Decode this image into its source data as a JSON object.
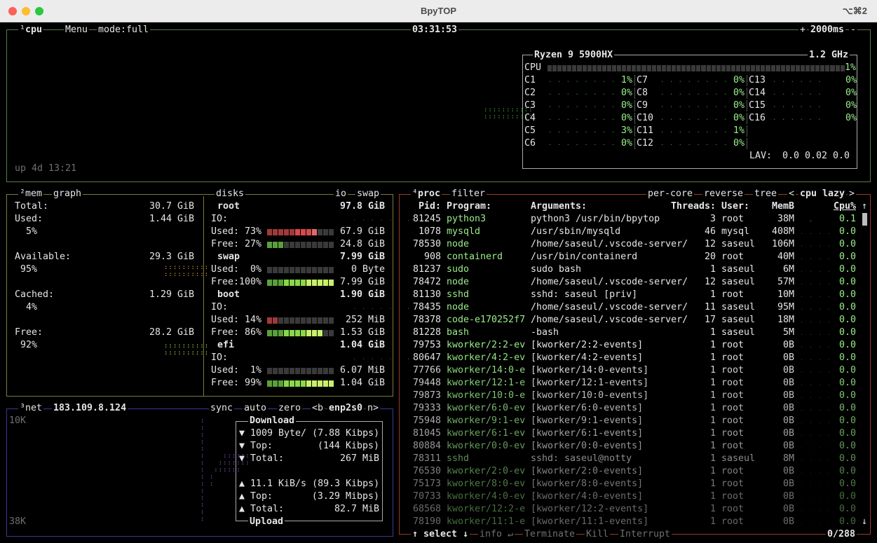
{
  "window": {
    "title": "BpyTOP",
    "shortcut": "⌥⌘2"
  },
  "cpu": {
    "num": "¹",
    "title": "cpu",
    "menu": "Menu",
    "mode": "mode:full",
    "time": "03:31:53",
    "plus": "+",
    "interval": "2000ms",
    "minus": "-",
    "uptime": "up 4d 13:21",
    "model": "Ryzen 9 5900HX",
    "freq": "1.2 GHz",
    "total_label": "CPU",
    "total_pct": "1%",
    "cores": [
      {
        "name": "C1",
        "pct": "1%"
      },
      {
        "name": "C2",
        "pct": "0%"
      },
      {
        "name": "C3",
        "pct": "0%"
      },
      {
        "name": "C4",
        "pct": "0%"
      },
      {
        "name": "C5",
        "pct": "3%"
      },
      {
        "name": "C6",
        "pct": "0%"
      },
      {
        "name": "C7",
        "pct": "0%"
      },
      {
        "name": "C8",
        "pct": "0%"
      },
      {
        "name": "C9",
        "pct": "0%"
      },
      {
        "name": "C10",
        "pct": "0%"
      },
      {
        "name": "C11",
        "pct": "1%"
      },
      {
        "name": "C12",
        "pct": "0%"
      },
      {
        "name": "C13",
        "pct": "0%"
      },
      {
        "name": "C14",
        "pct": "0%"
      },
      {
        "name": "C15",
        "pct": "0%"
      },
      {
        "name": "C16",
        "pct": "0%"
      }
    ],
    "lav_label": "LAV:",
    "lav": "0.0 0.02 0.0"
  },
  "mem": {
    "num": "²",
    "title": "mem",
    "graph": "graph",
    "total_l": "Total:",
    "total_v": "30.7 GiB",
    "used_l": "Used:",
    "used_v": "1.44 GiB",
    "used_p": "5%",
    "avail_l": "Available:",
    "avail_v": "29.3 GiB",
    "avail_p": "95%",
    "cached_l": "Cached:",
    "cached_v": "1.29 GiB",
    "cached_p": "4%",
    "free_l": "Free:",
    "free_v": "28.2 GiB",
    "free_p": "92%"
  },
  "disks": {
    "title": "disks",
    "io": "io",
    "swap": "swap",
    "io_label": "IO:",
    "items": [
      {
        "name": "root",
        "total": "97.8 GiB",
        "has_io": true,
        "used_l": "Used: 73%",
        "used_v": "67.9 GiB",
        "used_frac": 0.73,
        "free_l": "Free: 27%",
        "free_v": "24.8 GiB",
        "free_frac": 0.27
      },
      {
        "name": "swap",
        "total": "7.99 GiB",
        "has_io": false,
        "used_l": "Used:  0%",
        "used_v": "0 Byte",
        "used_frac": 0.0,
        "free_l": "Free:100%",
        "free_v": "7.99 GiB",
        "free_frac": 1.0
      },
      {
        "name": "boot",
        "total": "1.90 GiB",
        "has_io": true,
        "used_l": "Used: 14%",
        "used_v": "252 MiB",
        "used_frac": 0.14,
        "free_l": "Free: 86%",
        "free_v": "1.53 GiB",
        "free_frac": 0.86
      },
      {
        "name": "efi",
        "total": "1.04 GiB",
        "has_io": true,
        "used_l": "Used:  1%",
        "used_v": "6.07 MiB",
        "used_frac": 0.01,
        "free_l": "Free: 99%",
        "free_v": "1.04 GiB",
        "free_frac": 0.99
      }
    ]
  },
  "net": {
    "num": "³",
    "title": "net",
    "ip": "183.109.8.124",
    "sync": "sync",
    "auto": "auto",
    "zero": "zero",
    "prev": "<b",
    "iface": "enp2s0",
    "next": "n>",
    "scale_top": "10K",
    "scale_bottom": "38K",
    "download": "Download",
    "dl_rate": "▼ 1009 Byte/ (7.88 Kibps)",
    "dl_top_l": "▼ Top:",
    "dl_top_v": "(144 Kibps)",
    "dl_total_l": "▼ Total:",
    "dl_total_v": "267 MiB",
    "ul_rate": "▲ 11.1 KiB/s (89.3 Kibps)",
    "ul_top_l": "▲ Top:",
    "ul_top_v": "(3.29 Mibps)",
    "ul_total_l": "▲ Total:",
    "ul_total_v": "82.7 MiB",
    "upload": "Upload"
  },
  "proc": {
    "num": "⁴",
    "title": "proc",
    "filter": "filter",
    "percore": "per-core",
    "reverse": "reverse",
    "tree": "tree",
    "lt": "<",
    "sort": "cpu lazy",
    "gt": ">",
    "headers": {
      "pid": "Pid:",
      "program": "Program:",
      "args": "Arguments:",
      "threads": "Threads:",
      "user": "User:",
      "mem": "MemB",
      "cpu": "Cpu%"
    },
    "up_arrow": "↑",
    "down_arrow": "↓",
    "rows": [
      [
        "81245",
        "python3",
        "python3 /usr/bin/bpytop",
        "3",
        "root",
        "38M",
        "0.1"
      ],
      [
        "1078",
        "mysqld",
        "/usr/sbin/mysqld",
        "46",
        "mysql",
        "408M",
        "0.0"
      ],
      [
        "78530",
        "node",
        "/home/saseul/.vscode-server/",
        "12",
        "saseul",
        "106M",
        "0.0"
      ],
      [
        "908",
        "containerd",
        "/usr/bin/containerd",
        "20",
        "root",
        "40M",
        "0.0"
      ],
      [
        "81237",
        "sudo",
        "sudo bash",
        "1",
        "saseul",
        "6M",
        "0.0"
      ],
      [
        "78472",
        "node",
        "/home/saseul/.vscode-server/",
        "12",
        "saseul",
        "57M",
        "0.0"
      ],
      [
        "81130",
        "sshd",
        "sshd: saseul [priv]",
        "1",
        "root",
        "10M",
        "0.0"
      ],
      [
        "78435",
        "node",
        "/home/saseul/.vscode-server/",
        "11",
        "saseul",
        "95M",
        "0.0"
      ],
      [
        "78378",
        "code-e170252f7",
        "/home/saseul/.vscode-server/",
        "17",
        "saseul",
        "18M",
        "0.0"
      ],
      [
        "81228",
        "bash",
        "-bash",
        "1",
        "saseul",
        "5M",
        "0.0"
      ],
      [
        "79753",
        "kworker/2:2-ev",
        "[kworker/2:2-events]",
        "1",
        "root",
        "0B",
        "0.0"
      ],
      [
        "80647",
        "kworker/4:2-ev",
        "[kworker/4:2-events]",
        "1",
        "root",
        "0B",
        "0.0"
      ],
      [
        "77766",
        "kworker/14:0-e",
        "[kworker/14:0-events]",
        "1",
        "root",
        "0B",
        "0.0"
      ],
      [
        "79448",
        "kworker/12:1-e",
        "[kworker/12:1-events]",
        "1",
        "root",
        "0B",
        "0.0"
      ],
      [
        "79873",
        "kworker/10:0-e",
        "[kworker/10:0-events]",
        "1",
        "root",
        "0B",
        "0.0"
      ],
      [
        "79333",
        "kworker/6:0-ev",
        "[kworker/6:0-events]",
        "1",
        "root",
        "0B",
        "0.0"
      ],
      [
        "75948",
        "kworker/9:1-ev",
        "[kworker/9:1-events]",
        "1",
        "root",
        "0B",
        "0.0"
      ],
      [
        "81045",
        "kworker/6:1-ev",
        "[kworker/6:1-events]",
        "1",
        "root",
        "0B",
        "0.0"
      ],
      [
        "80884",
        "kworker/0:0-ev",
        "[kworker/0:0-events]",
        "1",
        "root",
        "0B",
        "0.0"
      ],
      [
        "78311",
        "sshd",
        "sshd: saseul@notty",
        "1",
        "saseul",
        "8M",
        "0.0"
      ],
      [
        "76530",
        "kworker/2:0-ev",
        "[kworker/2:0-events]",
        "1",
        "root",
        "0B",
        "0.0"
      ],
      [
        "75173",
        "kworker/8:0-ev",
        "[kworker/8:0-events]",
        "1",
        "root",
        "0B",
        "0.0"
      ],
      [
        "70733",
        "kworker/4:0-ev",
        "[kworker/4:0-events]",
        "1",
        "root",
        "0B",
        "0.0"
      ],
      [
        "68568",
        "kworker/12:2-e",
        "[kworker/12:2-events]",
        "1",
        "root",
        "0B",
        "0.0"
      ],
      [
        "78190",
        "kworker/11:1-e",
        "[kworker/11:1-events]",
        "1",
        "root",
        "0B",
        "0.0"
      ]
    ],
    "select": "↑ select ↓",
    "info": "info ↵",
    "terminate": "Terminate",
    "kill": "Kill",
    "interrupt": "Interrupt",
    "count": "0/288"
  },
  "colors": {
    "cpu_border": "#5a7a4a",
    "mem_border": "#7a7a3a",
    "net_border": "#3a3a9a",
    "proc_border": "#9a3a2a"
  }
}
